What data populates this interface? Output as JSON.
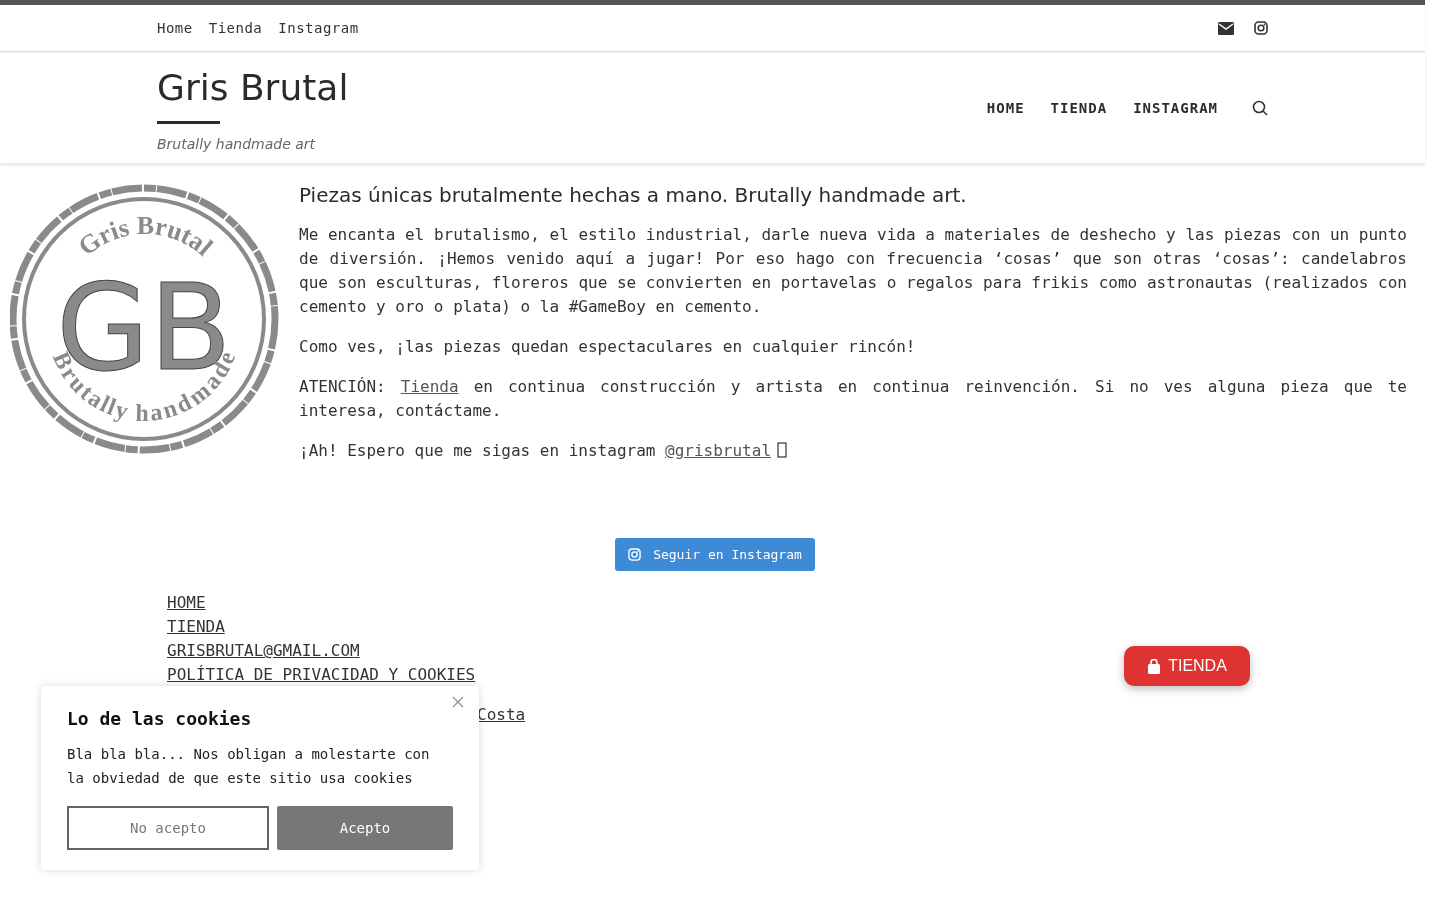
{
  "top_menu": [
    "Home",
    "Tienda",
    "Instagram"
  ],
  "site": {
    "title": "Gris Brutal",
    "tagline": "Brutally handmade art"
  },
  "main_menu": [
    "HOME",
    "TIENDA",
    "INSTAGRAM"
  ],
  "logo": {
    "ring_top": "Gris Brutal",
    "monogram": "GB",
    "ring_bottom": "Brutally handmade"
  },
  "intro": {
    "heading": "Piezas únicas brutalmente hechas a mano. Brutally handmade art.",
    "paragraphs": [
      [
        {
          "kind": "text",
          "text": "Me encanta el brutalismo, el estilo industrial, darle nueva vida a materiales de deshecho y las piezas con un punto de diversión. ¡Hemos venido aquí a jugar! Por eso hago con frecuencia ‘cosas’ que son otras ‘cosas’: candelabros que son esculturas, floreros que se convierten en portavelas o regalos para frikis como astronautas (realizados con cemento y oro o plata) o la #GameBoy en cemento."
        }
      ],
      [
        {
          "kind": "text",
          "text": "Como ves, ¡las piezas quedan espectaculares en cualquier rincón!"
        }
      ],
      [
        {
          "kind": "text",
          "text": "ATENCIÓN: "
        },
        {
          "kind": "link",
          "text": "Tienda"
        },
        {
          "kind": "text",
          "text": " en continua construcción y artista en continua reinvención. Si no ves alguna pieza que te interesa, contáctame."
        }
      ],
      [
        {
          "kind": "text",
          "text": "¡Ah! Espero que me sigas en instagram "
        },
        {
          "kind": "link",
          "text": "@grisbrutal"
        },
        {
          "kind": "glyph"
        }
      ]
    ]
  },
  "instagram_button": "Seguir en Instagram",
  "footer_links": [
    "HOME",
    "TIENDA",
    "GRISBRUTAL@GMAIL.COM",
    "POLÍTICA DE PRIVACIDAD Y COOKIES"
  ],
  "footer_credit": "Costa",
  "shop_button": "TIENDA",
  "cookie_notice": {
    "title": "Lo de las cookies",
    "text": "Bla bla bla... Nos obligan a molestarte con la obviedad de que este sitio usa cookies",
    "reject": "No acepto",
    "accept": "Acepto"
  }
}
